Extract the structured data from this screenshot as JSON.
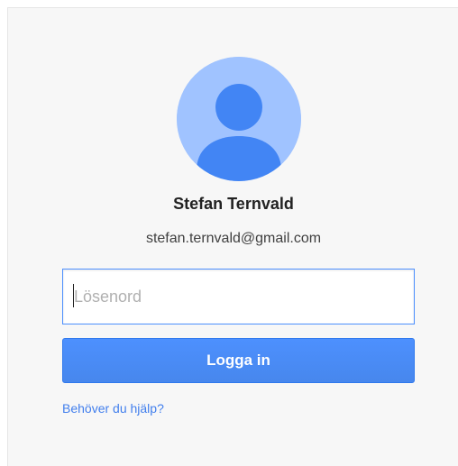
{
  "profile": {
    "name": "Stefan Ternvald",
    "email": "stefan.ternvald@gmail.com",
    "avatar_icon": "default-user-icon",
    "avatar_bg": "#a0c3ff",
    "avatar_fg": "#4285f4"
  },
  "form": {
    "password_placeholder": "Lösenord",
    "password_value": "",
    "login_label": "Logga in",
    "help_label": "Behöver du hjälp?"
  },
  "colors": {
    "accent": "#4d90fe",
    "link": "#427fed",
    "card_bg": "#f7f7f7"
  }
}
